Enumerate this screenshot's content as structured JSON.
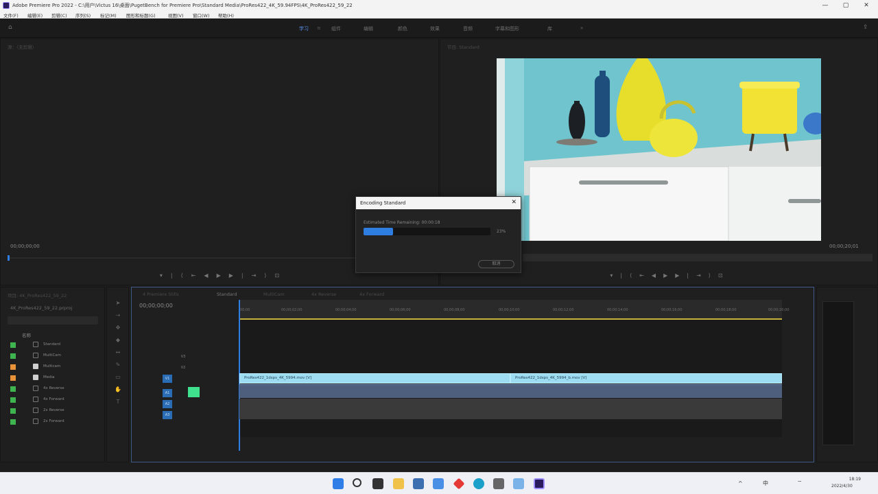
{
  "window": {
    "title": "Adobe Premiere Pro 2022 - C:\\用户\\Victus 16\\桌面\\PugetBench for Premiere Pro\\Standard Media\\ProRes422_4K_59.94FPS\\4K_ProRes422_59_22",
    "minimize": "—",
    "maximize": "▢",
    "close": "✕"
  },
  "menu": [
    "文件(F)",
    "编辑(E)",
    "剪辑(C)",
    "序列(S)",
    "标记(M)",
    "图形和标题(G)",
    "视图(V)",
    "窗口(W)",
    "帮助(H)"
  ],
  "workspaces": {
    "tabs": [
      "学习",
      "组件",
      "编辑",
      "颜色",
      "效果",
      "音频",
      "字幕和图形",
      "库"
    ],
    "active": "学习"
  },
  "source_panel": {
    "tab": "源：（无剪辑）",
    "timecode": "00;00;00;00"
  },
  "program_panel": {
    "tab": "节目: Standard",
    "timecode_end": "00;00;20;01"
  },
  "encoding_dialog": {
    "title": "Encoding Standard",
    "close": "✕",
    "estimated": "Estimated Time Remaining: 00:00:18",
    "percent_text": "23%",
    "progress": 0.23,
    "cancel": "取消"
  },
  "project_panel": {
    "tab": "项目: 4K_ProRes422_59_22",
    "file": "4K_ProRes422_59_22.prproj",
    "column": "名称",
    "items": [
      {
        "label": "Standard",
        "color": "#3fb34f"
      },
      {
        "label": "MultiCam",
        "color": "#3fb34f"
      },
      {
        "label": "Multicam",
        "color": "#e8923a"
      },
      {
        "label": "Media",
        "color": "#e8923a"
      },
      {
        "label": "4x Reverse",
        "color": "#3fb34f"
      },
      {
        "label": "4x Forward",
        "color": "#3fb34f"
      },
      {
        "label": "2x Reverse",
        "color": "#3fb34f"
      },
      {
        "label": "2x Forward",
        "color": "#3fb34f"
      }
    ]
  },
  "timeline": {
    "tabs": [
      "4 Premiere Stills",
      "Standard",
      "MultiCam",
      "4x Reverse",
      "4x Forward"
    ],
    "timecode": "00;00;00;00",
    "ruler": [
      "00;00",
      "00;00;02;00",
      "00;00;04;00",
      "00;00;06;00",
      "00;00;08;00",
      "00;00;10;00",
      "00;00;12;00",
      "00;00;14;00",
      "00;00;16;00",
      "00;00;18;00",
      "00;00;20;00"
    ],
    "tracks": {
      "video": [
        "V3",
        "V2",
        "V1"
      ],
      "audio": [
        "A1",
        "A2",
        "A3"
      ]
    },
    "clips": [
      {
        "label": "ProRes422_1dsps_4K_5994.mov [V]"
      },
      {
        "label": "ProRes422_1dsps_4K_5994_b.mov [V]"
      }
    ]
  },
  "taskbar": {
    "time": "18:19",
    "date": "2022/4/30",
    "ime": "中"
  }
}
